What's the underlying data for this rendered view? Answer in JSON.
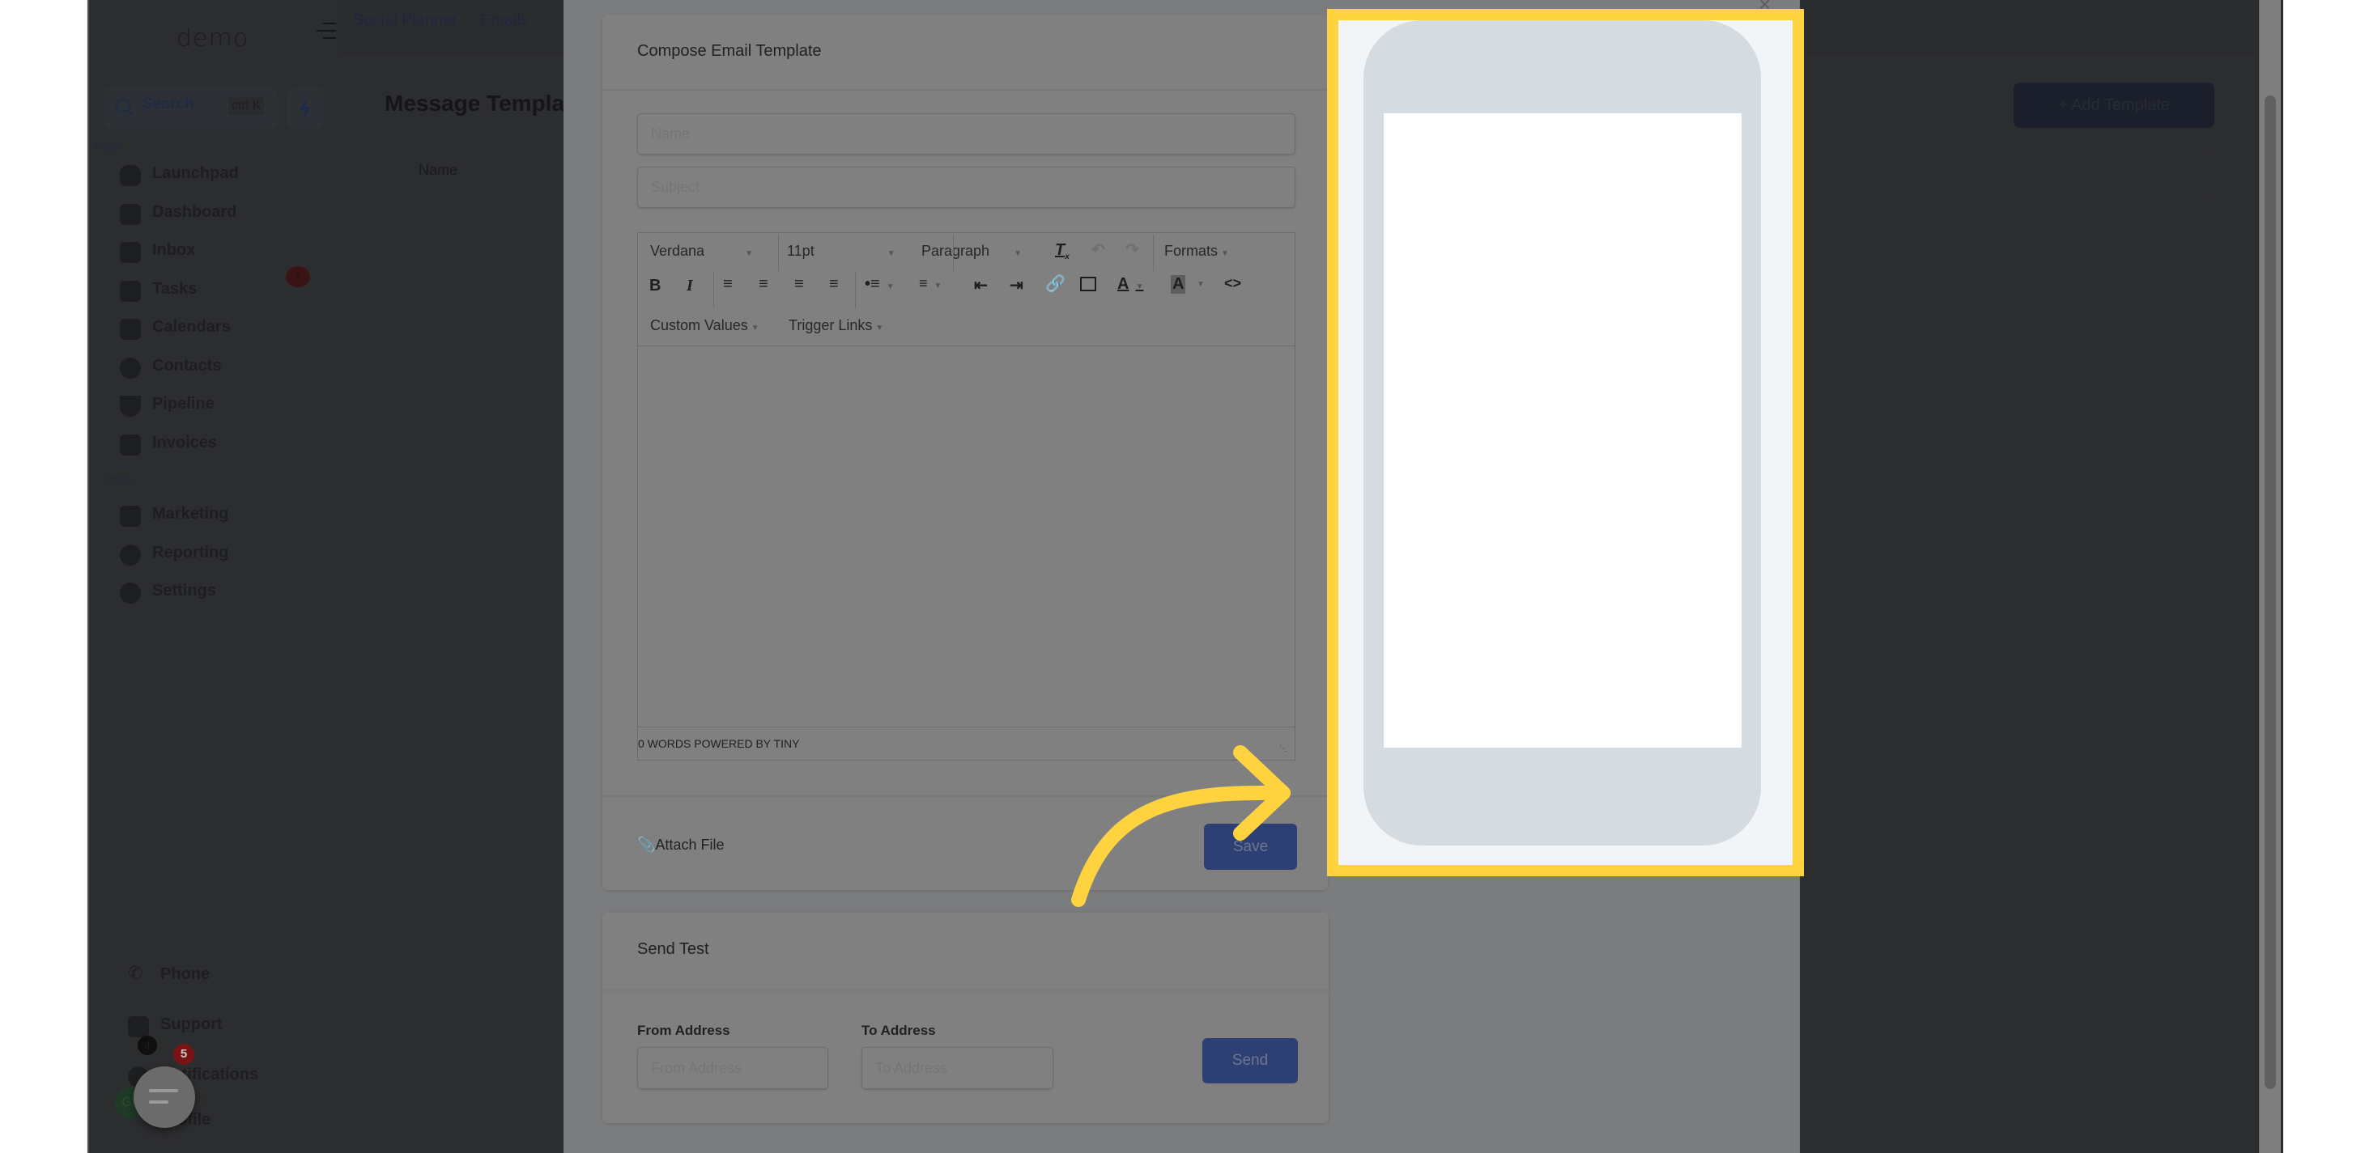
{
  "app": {
    "logo": "demo",
    "search": {
      "label": "Search",
      "shortcut": "ctrl K"
    },
    "sections": {
      "apps": "Apps",
      "tools": "Tools"
    },
    "sidebar_items": [
      {
        "label": "Launchpad",
        "icon": "launchpad-icon"
      },
      {
        "label": "Dashboard",
        "icon": "dashboard-icon"
      },
      {
        "label": "Inbox",
        "icon": "inbox-icon",
        "badge": "1"
      },
      {
        "label": "Tasks",
        "icon": "tasks-icon"
      },
      {
        "label": "Calendars",
        "icon": "calendar-icon"
      },
      {
        "label": "Contacts",
        "icon": "contacts-icon"
      },
      {
        "label": "Pipeline",
        "icon": "pipeline-icon"
      },
      {
        "label": "Invoices",
        "icon": "invoices-icon"
      }
    ],
    "tool_items": [
      {
        "label": "Marketing",
        "icon": "megaphone-icon"
      },
      {
        "label": "Reporting",
        "icon": "pie-chart-icon"
      },
      {
        "label": "Settings",
        "icon": "gear-icon"
      }
    ],
    "bottom_items": [
      {
        "label": "Phone",
        "icon": "phone-icon"
      },
      {
        "label": "Support",
        "icon": "support-icon"
      },
      {
        "label": "Notifications",
        "icon": "bell-icon",
        "badge": "4"
      },
      {
        "label": "Profile",
        "icon": "avatar",
        "initials": "GP"
      }
    ],
    "chat_widget": {
      "badge": "5"
    },
    "top_nav": {
      "items": [
        "Social Planner",
        "Emails"
      ]
    },
    "page_title": "Message Templates",
    "table": {
      "columns": [
        "Name"
      ]
    },
    "add_template_label": "+ Add Template"
  },
  "modal": {
    "close_label": "×",
    "compose": {
      "title": "Compose Email Template",
      "name_placeholder": "Name",
      "subject_placeholder": "Subject",
      "editor": {
        "font": "Verdana",
        "size": "11pt",
        "block": "Paragraph",
        "formats": "Formats",
        "custom_values": "Custom Values",
        "trigger_links": "Trigger Links",
        "status": "0 WORDS POWERED BY TINY"
      },
      "attach_label": "Attach File",
      "save_label": "Save"
    },
    "send_test": {
      "title": "Send Test",
      "from_label": "From Address",
      "from_placeholder": "From Address",
      "to_label": "To Address",
      "to_placeholder": "To Address",
      "send_label": "Send"
    }
  },
  "colors": {
    "highlight": "#ffd340",
    "primary_button": "#2e3f73",
    "phone_frame": "#d4dbe1"
  }
}
